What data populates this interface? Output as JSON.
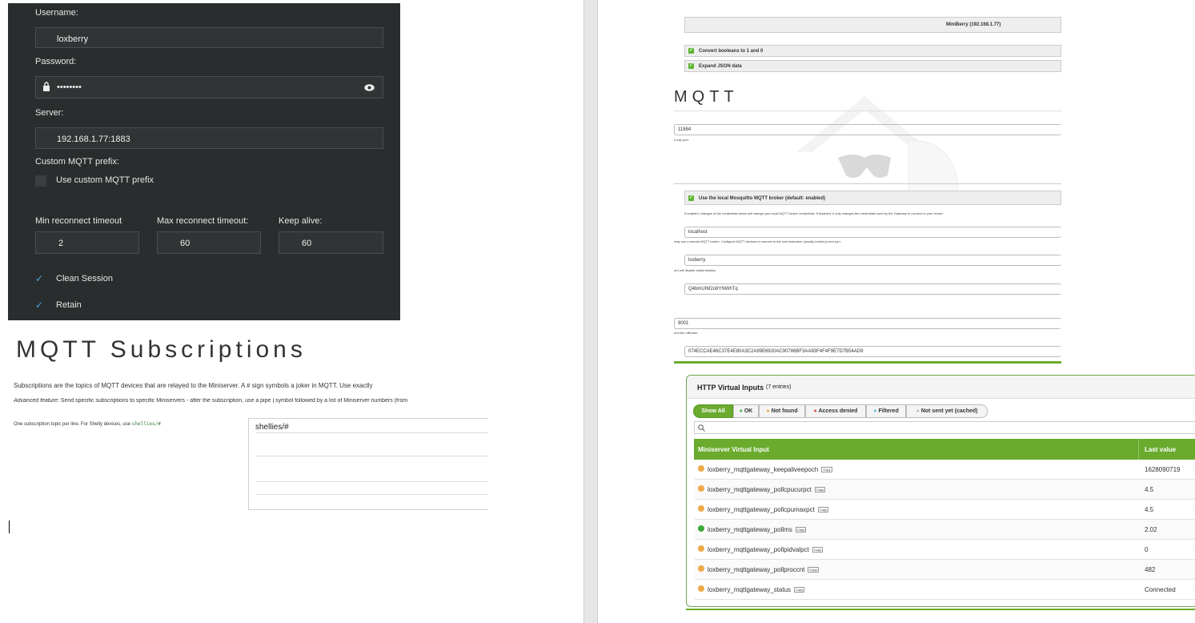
{
  "mqtt_app": {
    "username_label": "Username:",
    "username_value": "loxberry",
    "password_label": "Password:",
    "password_value": "••••••••",
    "server_label": "Server:",
    "server_value": "192.168.1.77:1883",
    "custom_prefix_label": "Custom MQTT prefix:",
    "custom_prefix_checkbox": "Use custom MQTT prefix",
    "min_reconnect_label": "Min reconnect timeout",
    "min_reconnect_value": "2",
    "max_reconnect_label": "Max reconnect timeout:",
    "max_reconnect_value": "60",
    "keep_alive_label": "Keep alive:",
    "keep_alive_value": "60",
    "clean_session_label": "Clean Session",
    "retain_label": "Retain"
  },
  "subscriptions": {
    "title": "MQTT Subscriptions",
    "intro": "Subscriptions are the topics of MQTT devices that are relayed to the Miniserver. A # sign symbols a joker in MQTT. Use exactly",
    "advanced_prefix": "Advanced feature:",
    "advanced_text": " Send specific subscriptions to specific Miniservers - after the subscription, use a pipe | symbol followed by a list of Miniserver numbers (from",
    "hint_text": "One subscription topic per line. For Shelly devices, use ",
    "hint_code": "shellies/#",
    "lines": [
      "shellies/#",
      "",
      "",
      ""
    ]
  },
  "gateway": {
    "miniserver_header": "MiniBerry (192.168.1.77)",
    "convert_booleans": "Convert booleans to 1 and 0",
    "expand_json": "Expand JSON data",
    "mqtt_heading": "MQTT",
    "udp_port_value": "11884",
    "udp_port_hint": "s udp port.",
    "use_local_broker": "Use the local Mosquitto MQTT broker (default: enabled)",
    "broker_hint": "If enabled, changes of the credentials below will change your local MQTT broker credentials. If disabled, it only changes the credentials used by the Gateway to connect to your broker.",
    "host_value": "localhost",
    "host_hint": "may use a remote MQTT broker. Configure MQTT devices to connect to the real hostname (usually loxberry) and port.",
    "user_value": "loxberry",
    "user_hint": "ord will disable authentication.",
    "pass_value": "Q4bmUIM2o8YNWhTq",
    "ws_port_value": "9001",
    "ws_port_hint": "ons like ioBroker.",
    "hash_value": "074ECCAE46C37E4E80A3C2A99E6920AC90786BF3AA83F4F4F9E7D7B54AD9"
  },
  "http_inputs": {
    "title": "HTTP Virtual Inputs",
    "count": "(7 entries)",
    "filters": [
      "Show All",
      "OK",
      "Not found",
      "Access denied",
      "Filtered",
      "Not sent yet (cached)"
    ],
    "search_icon": "search-icon",
    "col_name": "Miniserver Virtual Input",
    "col_value": "Last value",
    "copy_label": "Copy",
    "rows": [
      {
        "name": "loxberry_mqttgateway_keepaliveepoch",
        "value": "1628090719",
        "status": "cached"
      },
      {
        "name": "loxberry_mqttgateway_pollcpucurpct",
        "value": "4.5",
        "status": "cached"
      },
      {
        "name": "loxberry_mqttgateway_pollcpumaxpct",
        "value": "4.5",
        "status": "cached"
      },
      {
        "name": "loxberry_mqttgateway_pollms",
        "value": "2.02",
        "status": "ok"
      },
      {
        "name": "loxberry_mqttgateway_pollpidvalpct",
        "value": "0",
        "status": "cached"
      },
      {
        "name": "loxberry_mqttgateway_pollproccnt",
        "value": "482",
        "status": "cached"
      },
      {
        "name": "loxberry_mqttgateway_status",
        "value": "Connected",
        "status": "cached"
      }
    ],
    "colors": {
      "green": "#6aab2e",
      "ok": "#3daa3d",
      "cached": "#f0a94a",
      "denied": "#d9534f",
      "filtered": "#5bc0de"
    }
  }
}
